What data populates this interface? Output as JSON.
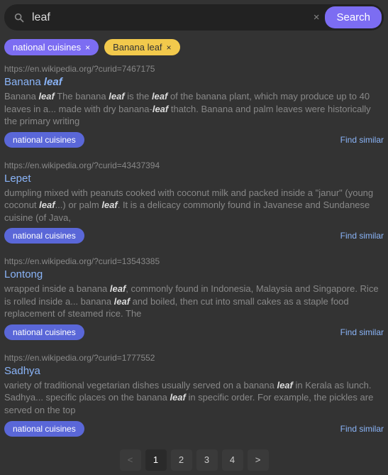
{
  "search": {
    "value": "leaf",
    "placeholder": "",
    "button_label": "Search",
    "clear_label": "×"
  },
  "filters": [
    {
      "label": "national cuisines",
      "close": "×",
      "style": "purple"
    },
    {
      "label": "Banana leaf",
      "close": "×",
      "style": "yellow"
    }
  ],
  "results": [
    {
      "url": "https://en.wikipedia.org/?curid=7467175",
      "title_parts": [
        {
          "text": "Banana ",
          "hl": false
        },
        {
          "text": "leaf",
          "hl": true
        }
      ],
      "snippet_parts": [
        {
          "text": "Banana ",
          "hl": false
        },
        {
          "text": "leaf",
          "hl": true
        },
        {
          "text": " The banana ",
          "hl": false
        },
        {
          "text": "leaf",
          "hl": true
        },
        {
          "text": " is the ",
          "hl": false
        },
        {
          "text": "leaf",
          "hl": true
        },
        {
          "text": " of the banana plant, which may produce up to 40 leaves in a... made with dry banana-",
          "hl": false
        },
        {
          "text": "leaf",
          "hl": true
        },
        {
          "text": " thatch. Banana and palm leaves were historically the primary writing",
          "hl": false
        }
      ],
      "tag": "national cuisines",
      "similar": "Find similar"
    },
    {
      "url": "https://en.wikipedia.org/?curid=43437394",
      "title_parts": [
        {
          "text": "Lepet",
          "hl": false
        }
      ],
      "snippet_parts": [
        {
          "text": "dumpling mixed with peanuts cooked with coconut milk and packed inside a \"janur\" (young coconut ",
          "hl": false
        },
        {
          "text": "leaf",
          "hl": true
        },
        {
          "text": "...) or palm ",
          "hl": false
        },
        {
          "text": "leaf",
          "hl": true
        },
        {
          "text": ". It is a delicacy commonly found in Javanese and Sundanese cuisine (of Java,",
          "hl": false
        }
      ],
      "tag": "national cuisines",
      "similar": "Find similar"
    },
    {
      "url": "https://en.wikipedia.org/?curid=13543385",
      "title_parts": [
        {
          "text": "Lontong",
          "hl": false
        }
      ],
      "snippet_parts": [
        {
          "text": "wrapped inside a banana ",
          "hl": false
        },
        {
          "text": "leaf",
          "hl": true
        },
        {
          "text": ", commonly found in Indonesia, Malaysia and Singapore. Rice is rolled inside a... banana ",
          "hl": false
        },
        {
          "text": "leaf",
          "hl": true
        },
        {
          "text": " and boiled, then cut into small cakes as a staple food replacement of steamed rice. The",
          "hl": false
        }
      ],
      "tag": "national cuisines",
      "similar": "Find similar"
    },
    {
      "url": "https://en.wikipedia.org/?curid=1777552",
      "title_parts": [
        {
          "text": "Sadhya",
          "hl": false
        }
      ],
      "snippet_parts": [
        {
          "text": "variety of traditional vegetarian dishes usually served on a banana ",
          "hl": false
        },
        {
          "text": "leaf",
          "hl": true
        },
        {
          "text": " in Kerala as lunch. Sadhya... specific places on the banana ",
          "hl": false
        },
        {
          "text": "leaf",
          "hl": true
        },
        {
          "text": " in specific order. For example, the pickles are served on the top",
          "hl": false
        }
      ],
      "tag": "national cuisines",
      "similar": "Find similar"
    }
  ],
  "pagination": {
    "prev": "<",
    "pages": [
      "1",
      "2",
      "3",
      "4"
    ],
    "current": "1",
    "next": ">"
  }
}
